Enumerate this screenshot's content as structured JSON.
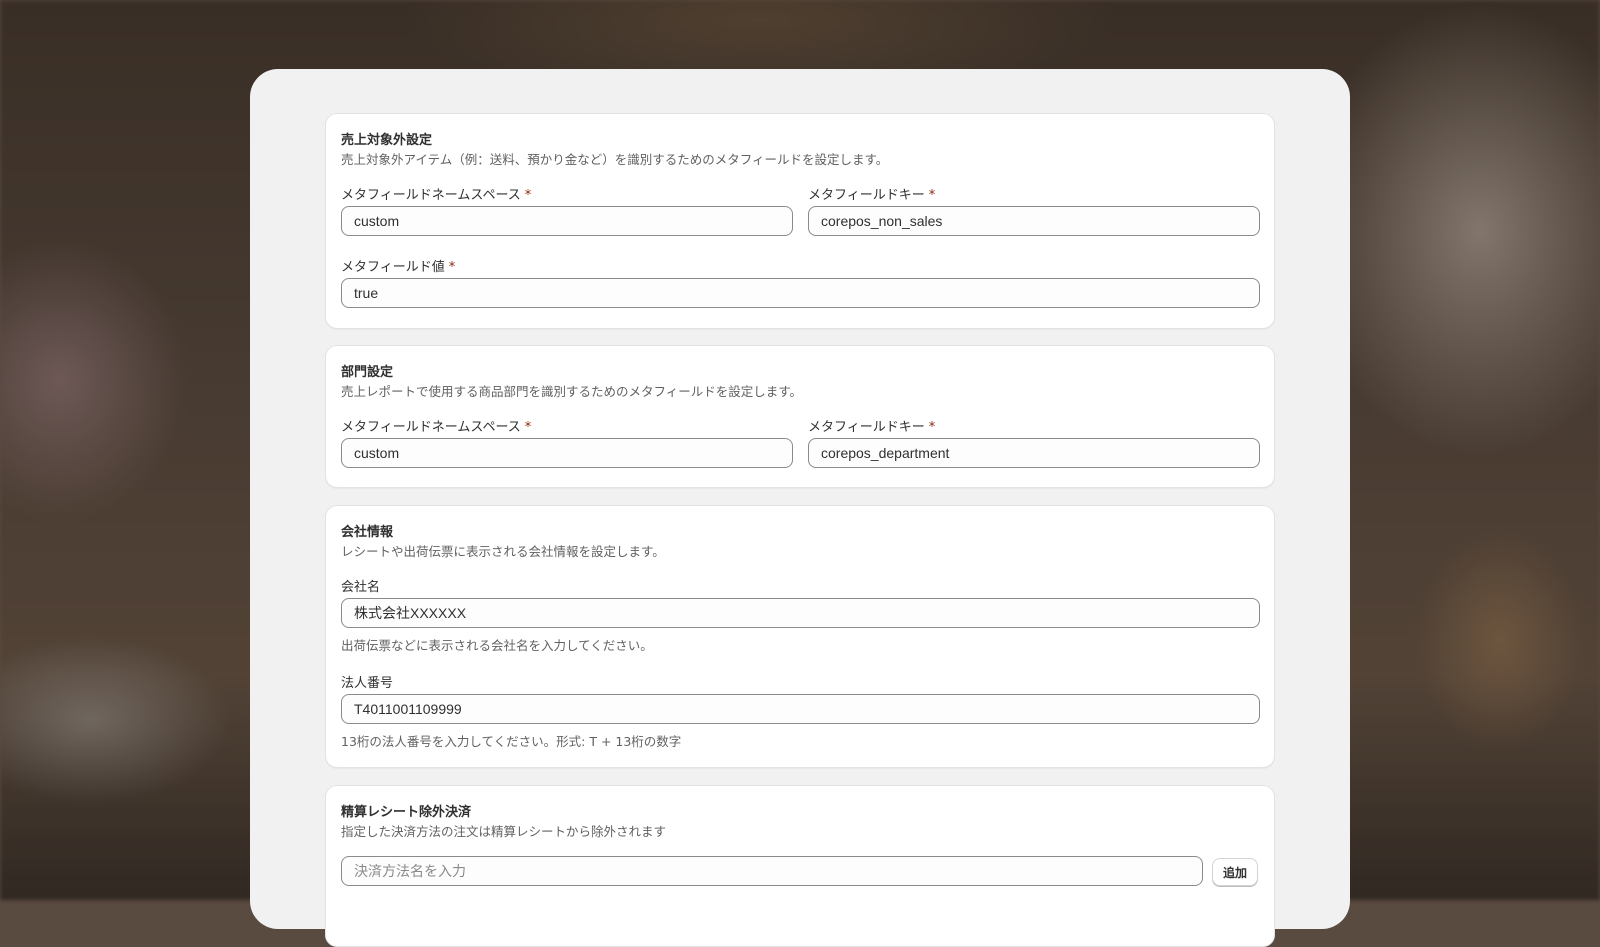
{
  "non_sales": {
    "title": "売上対象外設定",
    "description": "売上対象外アイテム（例：送料、預かり金など）を識別するためのメタフィールドを設定します。",
    "namespace_label": "メタフィールドネームスペース",
    "namespace_value": "custom",
    "key_label": "メタフィールドキー",
    "key_value": "corepos_non_sales",
    "value_label": "メタフィールド値",
    "value_value": "true"
  },
  "department": {
    "title": "部門設定",
    "description": "売上レポートで使用する商品部門を識別するためのメタフィールドを設定します。",
    "namespace_label": "メタフィールドネームスペース",
    "namespace_value": "custom",
    "key_label": "メタフィールドキー",
    "key_value": "corepos_department"
  },
  "company": {
    "title": "会社情報",
    "description": "レシートや出荷伝票に表示される会社情報を設定します。",
    "name_label": "会社名",
    "name_value": "株式会社XXXXXX",
    "name_help": "出荷伝票などに表示される会社名を入力してください。",
    "corp_label": "法人番号",
    "corp_value": "T4011001109999",
    "corp_help": "13桁の法人番号を入力してください。形式: T + 13桁の数字"
  },
  "settlement_exclude": {
    "title": "精算レシート除外決済",
    "description": "指定した決済方法の注文は精算レシートから除外されます",
    "input_placeholder": "決済方法名を入力",
    "add_button": "追加"
  },
  "required_mark": "*",
  "colors": {
    "panel_bg": "#f1f1f1",
    "card_bg": "#ffffff",
    "required": "#8e1f0b"
  }
}
